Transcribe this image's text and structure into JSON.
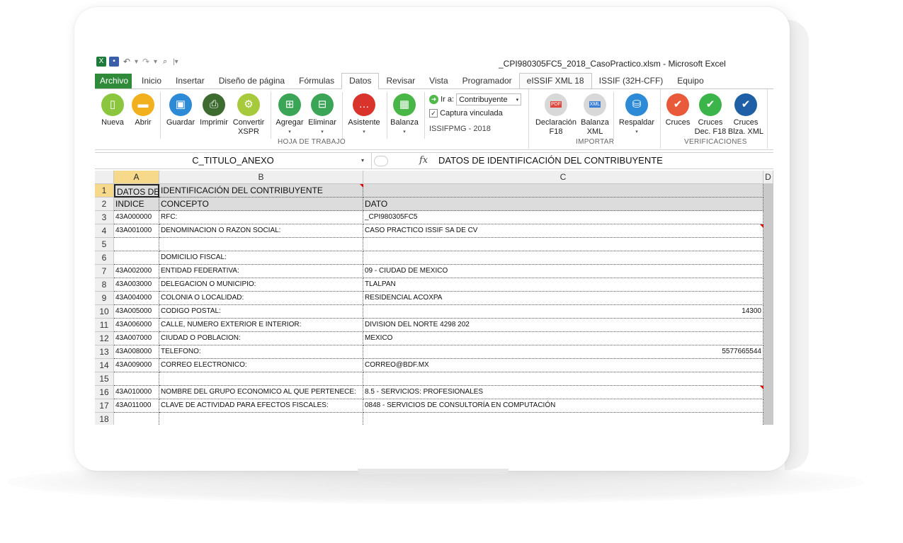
{
  "window": {
    "title": "_CPI980305FC5_2018_CasoPractico.xlsm  -  Microsoft Excel"
  },
  "tabs": [
    {
      "label": "Archivo"
    },
    {
      "label": "Inicio"
    },
    {
      "label": "Insertar"
    },
    {
      "label": "Diseño de página"
    },
    {
      "label": "Fórmulas"
    },
    {
      "label": "Datos"
    },
    {
      "label": "Revisar"
    },
    {
      "label": "Vista"
    },
    {
      "label": "Programador"
    },
    {
      "label": "eISSIF XML 18"
    },
    {
      "label": "ISSIF (32H-CFF)"
    },
    {
      "label": "Equipo"
    }
  ],
  "ribbon": {
    "nueva": "Nueva",
    "abrir": "Abrir",
    "guardar": "Guardar",
    "imprimir": "Imprimir",
    "convertir_1": "Convertir",
    "convertir_2": "XSPR",
    "agregar": "Agregar",
    "eliminar": "Eliminar",
    "asistente": "Asistente",
    "balanza": "Balanza",
    "ir_a": "Ir a:",
    "ir_a_value": "Contribuyente",
    "captura": "Captura vinculada",
    "version": "ISSIFPMG - 2018",
    "declaracion_1": "Declaración",
    "declaracion_2": "F18",
    "balanza_xml_1": "Balanza",
    "balanza_xml_2": "XML",
    "respaldar": "Respaldar",
    "cruces": "Cruces",
    "cruces_dec_1": "Cruces",
    "cruces_dec_2": "Dec. F18",
    "cruces_blza_1": "Cruces",
    "cruces_blza_2": "Blza. XML",
    "pdf_badge": "PDF",
    "xml_badge": "XML",
    "group_hoja": "HOJA DE TRABAJO",
    "group_importar": "IMPORTAR",
    "group_verificaciones": "VERIFICACIONES"
  },
  "formula_bar": {
    "name_box": "C_TITULO_ANEXO",
    "fx": "fx",
    "content": "DATOS DE IDENTIFICACIÓN DEL CONTRIBUYENTE"
  },
  "columns": [
    "A",
    "B",
    "C",
    "D"
  ],
  "rows": [
    {
      "n": "1",
      "a": "DATOS DE",
      "b": "IDENTIFICACIÓN DEL CONTRIBUYENTE",
      "c": ""
    },
    {
      "n": "2",
      "a": "INDICE",
      "b": "CONCEPTO",
      "c": "DATO"
    },
    {
      "n": "3",
      "a": "43A000000",
      "b": "RFC:",
      "c": "_CPI980305FC5"
    },
    {
      "n": "4",
      "a": "43A001000",
      "b": "DENOMINACION O RAZON SOCIAL:",
      "c": "CASO PRACTICO ISSIF SA DE CV"
    },
    {
      "n": "5",
      "a": "",
      "b": "",
      "c": ""
    },
    {
      "n": "6",
      "a": "",
      "b": "DOMICILIO FISCAL:",
      "c": ""
    },
    {
      "n": "7",
      "a": "43A002000",
      "b": "ENTIDAD FEDERATIVA:",
      "c": "09 - CIUDAD DE MEXICO"
    },
    {
      "n": "8",
      "a": "43A003000",
      "b": "DELEGACION O MUNICIPIO:",
      "c": "TLALPAN"
    },
    {
      "n": "9",
      "a": "43A004000",
      "b": "COLONIA O LOCALIDAD:",
      "c": "RESIDENCIAL ACOXPA"
    },
    {
      "n": "10",
      "a": "43A005000",
      "b": "CODIGO POSTAL:",
      "c": "14300"
    },
    {
      "n": "11",
      "a": "43A006000",
      "b": "CALLE, NUMERO EXTERIOR E INTERIOR:",
      "c": "DIVISION DEL NORTE 4298 202"
    },
    {
      "n": "12",
      "a": "43A007000",
      "b": "CIUDAD O POBLACION:",
      "c": "MEXICO"
    },
    {
      "n": "13",
      "a": "43A008000",
      "b": "TELEFONO:",
      "c": "5577665544"
    },
    {
      "n": "14",
      "a": "43A009000",
      "b": "CORREO ELECTRONICO:",
      "c": "CORREO@BDF.MX"
    },
    {
      "n": "15",
      "a": "",
      "b": "",
      "c": ""
    },
    {
      "n": "16",
      "a": "43A010000",
      "b": "NOMBRE DEL GRUPO ECONOMICO AL QUE PERTENECE:",
      "c": "8.5 - SERVICIOS: PROFESIONALES"
    },
    {
      "n": "17",
      "a": "43A011000",
      "b": "CLAVE DE ACTIVIDAD PARA EFECTOS FISCALES:",
      "c": "0848 - SERVICIOS DE CONSULTORÍA EN COMPUTACIÓN"
    },
    {
      "n": "18",
      "a": "",
      "b": "",
      "c": ""
    }
  ]
}
